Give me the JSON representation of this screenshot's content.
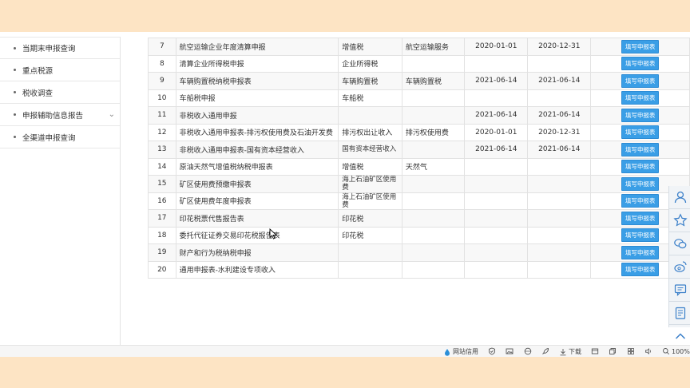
{
  "sidebar": {
    "items": [
      {
        "label": "当期末申报查询"
      },
      {
        "label": "重点税源"
      },
      {
        "label": "税收调查"
      },
      {
        "label": "申报辅助信息报告"
      },
      {
        "label": "全渠道申报查询"
      }
    ]
  },
  "table": {
    "rows": [
      {
        "no": "7",
        "name": "航空运输企业年度清算申报",
        "tax": "增值税",
        "item": "航空运输服务",
        "start": "2020-01-01",
        "end": "2020-12-31",
        "btn": "填写申报表"
      },
      {
        "no": "8",
        "name": "清算企业所得税申报",
        "tax": "企业所得税",
        "item": "",
        "start": "",
        "end": "",
        "btn": "填写申报表"
      },
      {
        "no": "9",
        "name": "车辆购置税纳税申报表",
        "tax": "车辆购置税",
        "item": "车辆购置税",
        "start": "2021-06-14",
        "end": "2021-06-14",
        "btn": "填写申报表"
      },
      {
        "no": "10",
        "name": "车船税申报",
        "tax": "车船税",
        "item": "",
        "start": "",
        "end": "",
        "btn": "填写申报表"
      },
      {
        "no": "11",
        "name": "非税收入通用申报",
        "tax": "",
        "item": "",
        "start": "2021-06-14",
        "end": "2021-06-14",
        "btn": "填写申报表"
      },
      {
        "no": "12",
        "name": "非税收入通用申报表-排污权使用费及石油开发费",
        "tax": "排污权出让收入",
        "item": "排污权使用费",
        "start": "2020-01-01",
        "end": "2020-12-31",
        "btn": "填写申报表"
      },
      {
        "no": "13",
        "name": "非税收入通用申报表-国有资本经营收入",
        "tax": "国有资本经营收入",
        "item": "",
        "start": "2021-06-14",
        "end": "2021-06-14",
        "btn": "填写申报表"
      },
      {
        "no": "14",
        "name": "原油天然气增值税纳税申报表",
        "tax": "增值税",
        "item": "天然气",
        "start": "",
        "end": "",
        "btn": "填写申报表"
      },
      {
        "no": "15",
        "name": "矿区使用费预缴申报表",
        "tax": "海上石油矿区使用费",
        "item": "",
        "start": "",
        "end": "",
        "btn": "填写申报表"
      },
      {
        "no": "16",
        "name": "矿区使用费年度申报表",
        "tax": "海上石油矿区使用费",
        "item": "",
        "start": "",
        "end": "",
        "btn": "填写申报表"
      },
      {
        "no": "17",
        "name": "印花税票代售报告表",
        "tax": "印花税",
        "item": "",
        "start": "",
        "end": "",
        "btn": "填写申报表"
      },
      {
        "no": "18",
        "name": "委托代征证券交易印花税报告表",
        "tax": "印花税",
        "item": "",
        "start": "",
        "end": "",
        "btn": "填写申报表"
      },
      {
        "no": "19",
        "name": "财产和行为税纳税申报",
        "tax": "",
        "item": "",
        "start": "",
        "end": "",
        "btn": "填写申报表"
      },
      {
        "no": "20",
        "name": "通用申报表-水利建设专项收入",
        "tax": "",
        "item": "",
        "start": "",
        "end": "",
        "btn": "填写申报表"
      }
    ]
  },
  "toolbar": {
    "icons": [
      "user-service-icon",
      "star-icon",
      "wechat-icon",
      "weibo-icon",
      "message-icon",
      "notice-icon",
      "scroll-top-icon"
    ]
  },
  "statusbar": {
    "site_credit": "网站信用",
    "download": "下载",
    "zoom": "100%"
  }
}
